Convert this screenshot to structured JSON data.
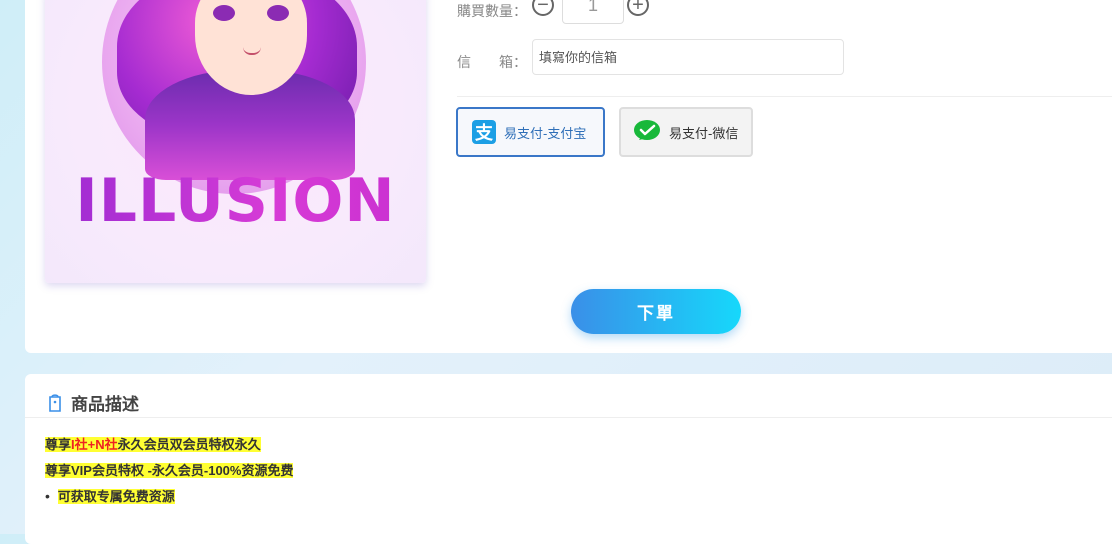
{
  "product": {
    "image_text": "ILLUSION"
  },
  "form": {
    "quantity_label": "購買數量：",
    "quantity_value": "1",
    "email_label_char1": "信",
    "email_label_char2": "箱：",
    "email_placeholder": "填寫你的信箱"
  },
  "payment": {
    "alipay_label": "易支付-支付宝",
    "alipay_icon_char": "支",
    "wechat_label": "易支付-微信"
  },
  "order_button": "下單",
  "description": {
    "title": "商品描述",
    "line1_a": "尊享",
    "line1_b": "I社+N社",
    "line1_c": "永久会员双会员特权永久",
    "line2": "尊享VIP会员特权 -永久会员-100%资源免费",
    "bullet_item": "可获取专属免费资源"
  },
  "colors": {
    "accent": "#3a77c8",
    "order_gradient_start": "#3a8fe8",
    "order_gradient_end": "#16d8fb",
    "highlight": "#ffff33"
  },
  "icons": {
    "minus": "minus-circle-icon",
    "plus": "plus-circle-icon",
    "alipay": "alipay-icon",
    "wechat": "wechat-icon",
    "description": "tag-icon"
  }
}
